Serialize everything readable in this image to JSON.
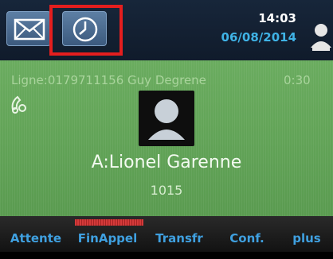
{
  "status_bar": {
    "time": "14:03",
    "date": "06/08/2014",
    "icons": [
      "messages-icon",
      "history-icon",
      "user-status-icon"
    ],
    "accent_color": "#3fb3e6"
  },
  "call": {
    "line_info": "Ligne:0179711156 Guy Degrene",
    "duration": "0:30",
    "contact_name": "A:Lionel Garenne",
    "contact_number": "1015",
    "background_color": "#5ea055"
  },
  "softkeys": [
    {
      "label": "Attente"
    },
    {
      "label": "FinAppel",
      "indicator_color": "#d43a3a"
    },
    {
      "label": "Transfr"
    },
    {
      "label": "Conf."
    },
    {
      "label": "plus"
    }
  ],
  "highlight_color": "#e41e1e"
}
